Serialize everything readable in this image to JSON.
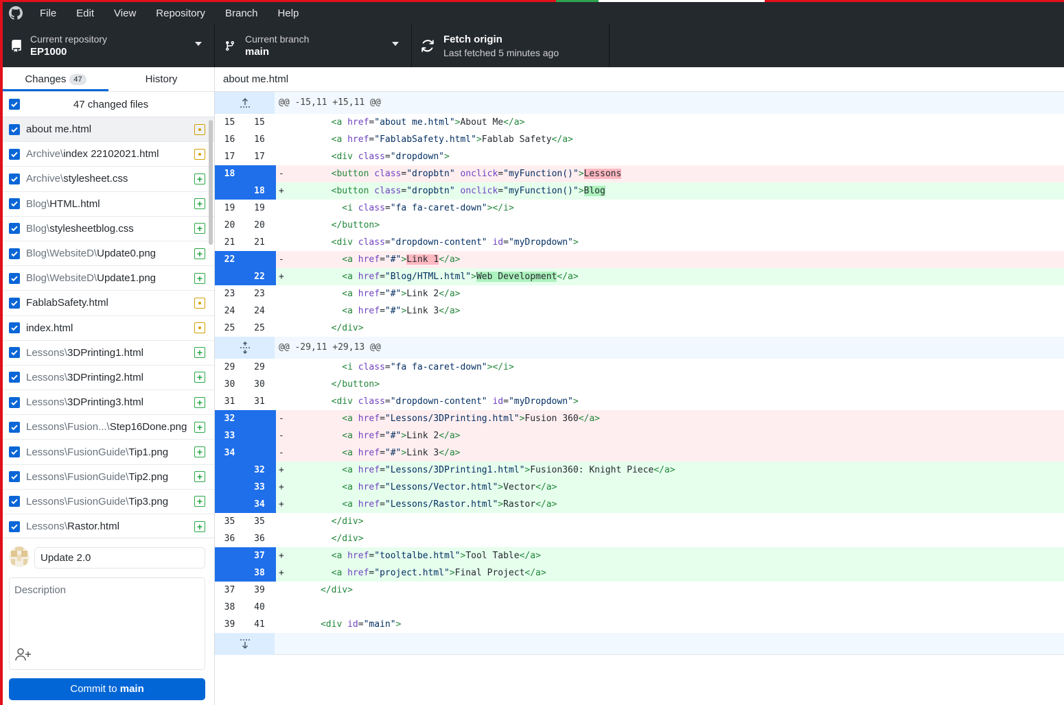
{
  "menubar": {
    "items": [
      "File",
      "Edit",
      "View",
      "Repository",
      "Branch",
      "Help"
    ]
  },
  "toolbar": {
    "repo": {
      "label": "Current repository",
      "value": "EP1000"
    },
    "branch": {
      "label": "Current branch",
      "value": "main"
    },
    "fetch": {
      "label": "Fetch origin",
      "sub": "Last fetched 5 minutes ago"
    }
  },
  "tabs": {
    "changes": "Changes",
    "changes_count": "47",
    "history": "History"
  },
  "changes_summary": "47 changed files",
  "files": [
    {
      "dir": "",
      "name": "about me.html",
      "status": "modified"
    },
    {
      "dir": "Archive\\",
      "name": "index 22102021.html",
      "status": "modified"
    },
    {
      "dir": "Archive\\",
      "name": "stylesheet.css",
      "status": "added"
    },
    {
      "dir": "Blog\\",
      "name": "HTML.html",
      "status": "added"
    },
    {
      "dir": "Blog\\",
      "name": "stylesheetblog.css",
      "status": "added"
    },
    {
      "dir": "Blog\\WebsiteD\\",
      "name": "Update0.png",
      "status": "added"
    },
    {
      "dir": "Blog\\WebsiteD\\",
      "name": "Update1.png",
      "status": "added"
    },
    {
      "dir": "",
      "name": "FablabSafety.html",
      "status": "modified"
    },
    {
      "dir": "",
      "name": "index.html",
      "status": "modified"
    },
    {
      "dir": "Lessons\\",
      "name": "3DPrinting1.html",
      "status": "added"
    },
    {
      "dir": "Lessons\\",
      "name": "3DPrinting2.html",
      "status": "added"
    },
    {
      "dir": "Lessons\\",
      "name": "3DPrinting3.html",
      "status": "added"
    },
    {
      "dir": "Lessons\\Fusion...\\",
      "name": "Step16Done.png",
      "status": "added"
    },
    {
      "dir": "Lessons\\FusionGuide\\",
      "name": "Tip1.png",
      "status": "added"
    },
    {
      "dir": "Lessons\\FusionGuide\\",
      "name": "Tip2.png",
      "status": "added"
    },
    {
      "dir": "Lessons\\FusionGuide\\",
      "name": "Tip3.png",
      "status": "added"
    },
    {
      "dir": "Lessons\\",
      "name": "Rastor.html",
      "status": "added"
    }
  ],
  "commit": {
    "summary": "Update 2.0",
    "description_placeholder": "Description",
    "button_prefix": "Commit to ",
    "button_branch": "main"
  },
  "diff": {
    "file": "about me.html",
    "lines": [
      {
        "type": "hunk",
        "text": "@@ -15,11 +15,11 @@",
        "icon": "expand-up"
      },
      {
        "type": "ctx",
        "o": "15",
        "n": "15",
        "text": "        <a href=\"about me.html\">About Me</a>"
      },
      {
        "type": "ctx",
        "o": "16",
        "n": "16",
        "text": "        <a href=\"FablabSafety.html\">Fablab Safety</a>"
      },
      {
        "type": "ctx",
        "o": "17",
        "n": "17",
        "text": "        <div class=\"dropdown\">"
      },
      {
        "type": "del",
        "o": "18",
        "n": "",
        "text": "        <button class=\"dropbtn\" onclick=\"myFunction()\">Lessons"
      },
      {
        "type": "add",
        "o": "",
        "n": "18",
        "text": "        <button class=\"dropbtn\" onclick=\"myFunction()\">Blog"
      },
      {
        "type": "ctx",
        "o": "19",
        "n": "19",
        "text": "          <i class=\"fa fa-caret-down\"></i>"
      },
      {
        "type": "ctx",
        "o": "20",
        "n": "20",
        "text": "        </button>"
      },
      {
        "type": "ctx",
        "o": "21",
        "n": "21",
        "text": "        <div class=\"dropdown-content\" id=\"myDropdown\">"
      },
      {
        "type": "del",
        "o": "22",
        "n": "",
        "text": "          <a href=\"#\">Link 1</a>"
      },
      {
        "type": "add",
        "o": "",
        "n": "22",
        "text": "          <a href=\"Blog/HTML.html\">Web Development</a>"
      },
      {
        "type": "ctx",
        "o": "23",
        "n": "23",
        "text": "          <a href=\"#\">Link 2</a>"
      },
      {
        "type": "ctx",
        "o": "24",
        "n": "24",
        "text": "          <a href=\"#\">Link 3</a>"
      },
      {
        "type": "ctx",
        "o": "25",
        "n": "25",
        "text": "        </div>"
      },
      {
        "type": "hunk",
        "text": "@@ -29,11 +29,13 @@",
        "icon": "expand-both"
      },
      {
        "type": "ctx",
        "o": "29",
        "n": "29",
        "text": "          <i class=\"fa fa-caret-down\"></i>"
      },
      {
        "type": "ctx",
        "o": "30",
        "n": "30",
        "text": "        </button>"
      },
      {
        "type": "ctx",
        "o": "31",
        "n": "31",
        "text": "        <div class=\"dropdown-content\" id=\"myDropdown\">"
      },
      {
        "type": "del",
        "o": "32",
        "n": "",
        "text": "          <a href=\"Lessons/3DPrinting.html\">Fusion 360</a>"
      },
      {
        "type": "del",
        "o": "33",
        "n": "",
        "text": "          <a href=\"#\">Link 2</a>"
      },
      {
        "type": "del",
        "o": "34",
        "n": "",
        "text": "          <a href=\"#\">Link 3</a>"
      },
      {
        "type": "add",
        "o": "",
        "n": "32",
        "text": "          <a href=\"Lessons/3DPrinting1.html\">Fusion360: Knight Piece</a>"
      },
      {
        "type": "add",
        "o": "",
        "n": "33",
        "text": "          <a href=\"Lessons/Vector.html\">Vector</a>"
      },
      {
        "type": "add",
        "o": "",
        "n": "34",
        "text": "          <a href=\"Lessons/Rastor.html\">Rastor</a>"
      },
      {
        "type": "ctx",
        "o": "35",
        "n": "35",
        "text": "        </div>"
      },
      {
        "type": "ctx",
        "o": "36",
        "n": "36",
        "text": "        </div>"
      },
      {
        "type": "add",
        "o": "",
        "n": "37",
        "text": "        <a href=\"tooltalbe.html\">Tool Table</a>"
      },
      {
        "type": "add",
        "o": "",
        "n": "38",
        "text": "        <a href=\"project.html\">Final Project</a>"
      },
      {
        "type": "ctx",
        "o": "37",
        "n": "39",
        "text": "      </div>"
      },
      {
        "type": "ctx",
        "o": "38",
        "n": "40",
        "text": ""
      },
      {
        "type": "ctx",
        "o": "39",
        "n": "41",
        "text": "      <div id=\"main\">"
      },
      {
        "type": "hunk",
        "text": "",
        "icon": "expand-down"
      }
    ]
  },
  "colors": {
    "accent": "#0366d6",
    "gutter_changed": "#1f6feb",
    "add_bg": "#e6ffed",
    "del_bg": "#ffeef0"
  }
}
